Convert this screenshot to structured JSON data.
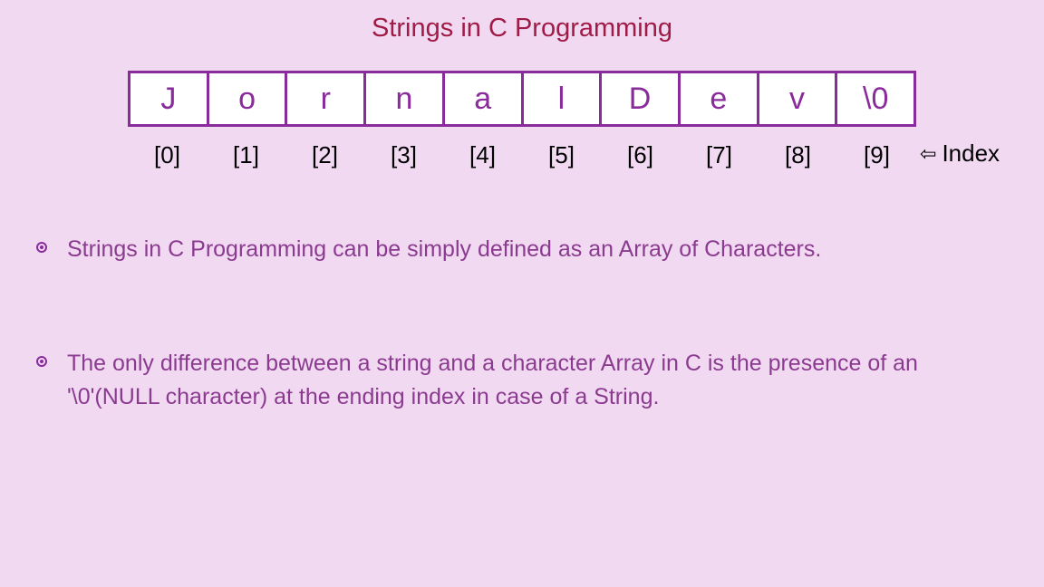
{
  "title": "Strings in C Programming",
  "cells": [
    "J",
    "o",
    "r",
    "n",
    "a",
    "l",
    "D",
    "e",
    "v",
    "\\0"
  ],
  "indices": [
    "[0]",
    "[1]",
    "[2]",
    "[3]",
    "[4]",
    "[5]",
    "[6]",
    "[7]",
    "[8]",
    "[9]"
  ],
  "index_label": "Index",
  "bullets": [
    "Strings in C Programming can be simply defined as an Array of Characters.",
    "The only difference between a string and a character Array in C is the presence of an '\\0'(NULL character) at the ending index in case of a String."
  ]
}
